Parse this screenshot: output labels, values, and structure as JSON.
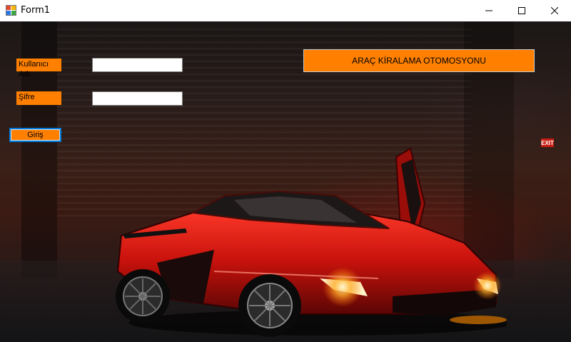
{
  "window": {
    "title": "Form1",
    "icon": "winforms-app-icon",
    "controls": {
      "minimize": "minimize-icon",
      "maximize": "maximize-icon",
      "close": "close-icon"
    }
  },
  "form": {
    "username_label": "Kullanıcı Adı",
    "username_value": "",
    "password_label": "Şifre",
    "password_value": "",
    "login_button": "Giriş",
    "banner": "ARAÇ KİRALAMA OTOMOSYONU"
  },
  "background": {
    "exit_sign": "EXIT"
  },
  "colors": {
    "accent": "#ff8000",
    "focus_border": "#0078d7",
    "titlebar": "#ffffff",
    "car": "#c8120c"
  }
}
